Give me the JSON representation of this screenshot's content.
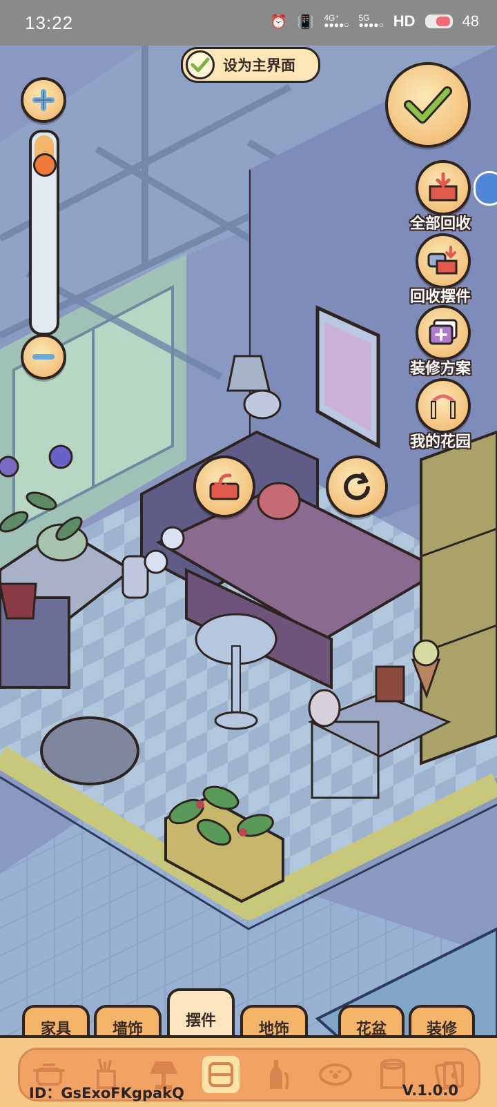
{
  "status_bar": {
    "time": "13:22",
    "network_1": "4G⁺",
    "network_2": "5G",
    "hd_label": "HD",
    "battery_level": "48"
  },
  "top": {
    "set_main_label": "设为主界面"
  },
  "right_actions": [
    {
      "label": "全部回收",
      "icon": "recycle-all-icon"
    },
    {
      "label": "回收摆件",
      "icon": "recycle-ornament-icon"
    },
    {
      "label": "装修方案",
      "icon": "decor-plan-icon"
    },
    {
      "label": "我的花园",
      "icon": "my-garden-icon"
    }
  ],
  "tabs": [
    {
      "label": "家具"
    },
    {
      "label": "墙饰"
    },
    {
      "label": "摆件",
      "active": true
    },
    {
      "label": "地饰"
    },
    {
      "label": "花盆"
    },
    {
      "label": "装修"
    }
  ],
  "category_icons": [
    "pot-icon",
    "stationery-icon",
    "lamp-icon",
    "cushion-icon",
    "bottle-icon",
    "pet-bowl-icon",
    "toilet-paper-icon",
    "card-icon"
  ],
  "footer": {
    "user_id": "ID：GsExoFKgpakQ",
    "version": "V.1.0.0"
  },
  "colors": {
    "accent_orange": "#f4b56b",
    "active_tab": "#fbe5bd",
    "outline": "#2d2320",
    "scene_overlay": "#7f8fb6"
  }
}
